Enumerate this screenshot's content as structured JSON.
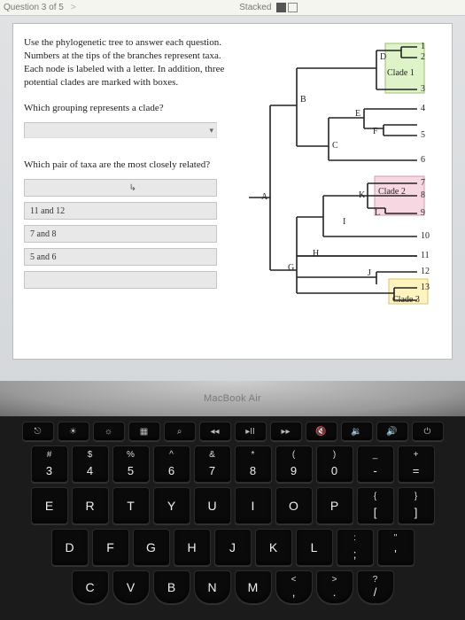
{
  "topbar": {
    "question_indicator": "Question 3 of 5",
    "chevron": ">",
    "mode_label": "Stacked"
  },
  "question": {
    "instructions": "Use the phylogenetic tree to answer each question. Numbers at the tips of the branches represent taxa. Each node is labeled with a letter. In addition, three potential clades are marked with boxes.",
    "prompt1": "Which grouping represents a clade?",
    "prompt2": "Which pair of taxa are the most closely related?",
    "dropdown_caret": "▾",
    "options": {
      "opt1": "11 and 12",
      "opt2": "7 and 8",
      "opt3": "5 and 6"
    }
  },
  "tree": {
    "tips": {
      "t1": "1",
      "t2": "2",
      "t3": "3",
      "t4": "4",
      "t5": "5",
      "t6": "6",
      "t7": "7",
      "t8": "8",
      "t9": "9",
      "t10": "10",
      "t11": "11",
      "t12": "12",
      "t13": "13"
    },
    "nodes": {
      "A": "A",
      "B": "B",
      "C": "C",
      "D": "D",
      "E": "E",
      "F": "F",
      "G": "G",
      "H": "H",
      "I": "I",
      "J": "J",
      "K": "K",
      "L": "L"
    },
    "clades": {
      "c1": "Clade 1",
      "c2": "Clade 2",
      "c3": "Clade 3"
    }
  },
  "laptop": {
    "model": "MacBook Air"
  },
  "keyboard": {
    "frow": {
      "k1": "⎋",
      "k2": "☀",
      "k3": "☼",
      "k4": "▦",
      "k5": "⌕",
      "k6": "◂◂",
      "k7": "▸II",
      "k8": "▸▸",
      "k9": "🔇",
      "k10": "🔉",
      "k11": "🔊",
      "k12": "⏻"
    },
    "row1": {
      "k1u": "#",
      "k1l": "3",
      "k2u": "$",
      "k2l": "4",
      "k3u": "%",
      "k3l": "5",
      "k4u": "^",
      "k4l": "6",
      "k5u": "&",
      "k5l": "7",
      "k6u": "*",
      "k6l": "8",
      "k7u": "(",
      "k7l": "9",
      "k8u": ")",
      "k8l": "0",
      "k9u": "_",
      "k9l": "-",
      "k10u": "+",
      "k10l": "="
    },
    "row2": {
      "k1": "E",
      "k2": "R",
      "k3": "T",
      "k4": "Y",
      "k5": "U",
      "k6": "I",
      "k7": "O",
      "k8": "P",
      "k9u": "{",
      "k9l": "[",
      "k10u": "}",
      "k10l": "]"
    },
    "row3": {
      "k1": "D",
      "k2": "F",
      "k3": "G",
      "k4": "H",
      "k5": "J",
      "k6": "K",
      "k7": "L",
      "k8u": ":",
      "k8l": ";",
      "k9u": "\"",
      "k9l": "'"
    },
    "row4": {
      "k1": "C",
      "k2": "V",
      "k3": "B",
      "k4": "N",
      "k5": "M",
      "k6u": "<",
      "k6l": ",",
      "k7u": ">",
      "k7l": ".",
      "k8u": "?",
      "k8l": "/"
    }
  }
}
